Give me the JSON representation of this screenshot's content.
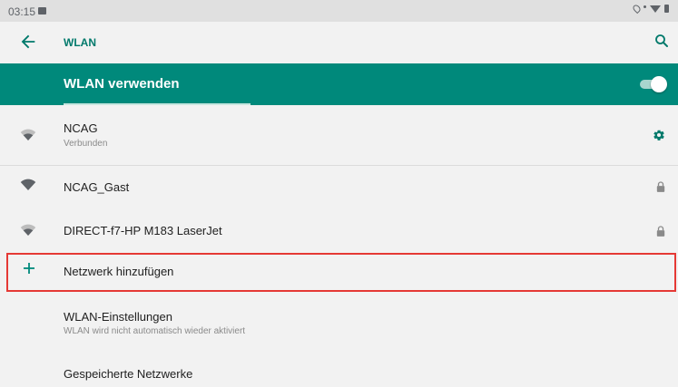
{
  "status_bar": {
    "time": "03:15",
    "icons": [
      "notification-icon",
      "location-icon",
      "wifi-signal-icon",
      "battery-icon"
    ]
  },
  "app_bar": {
    "title": "WLAN",
    "back_icon": "back-arrow-icon",
    "search_icon": "search-icon"
  },
  "master_switch": {
    "label": "WLAN verwenden",
    "checked": true
  },
  "networks": [
    {
      "name": "NCAG",
      "status": "Verbunden",
      "icon": "wifi-icon",
      "action_icon": "gear-icon",
      "secured": false
    },
    {
      "name": "NCAG_Gast",
      "icon": "wifi-icon",
      "action_icon": "lock-icon",
      "secured": true
    },
    {
      "name": "DIRECT-f7-HP M183 LaserJet",
      "icon": "wifi-icon",
      "action_icon": "lock-icon",
      "secured": true
    }
  ],
  "add_network": {
    "label": "Netzwerk hinzufügen",
    "icon": "plus-icon"
  },
  "wlan_settings": {
    "title": "WLAN-Einstellungen",
    "subtitle": "WLAN wird nicht automatisch wieder aktiviert"
  },
  "saved_networks": {
    "title": "Gespeicherte Netzwerke"
  },
  "colors": {
    "accent": "#00897b",
    "accent_text": "#00796b",
    "background": "#f2f2f2",
    "highlight": "#e53935"
  }
}
